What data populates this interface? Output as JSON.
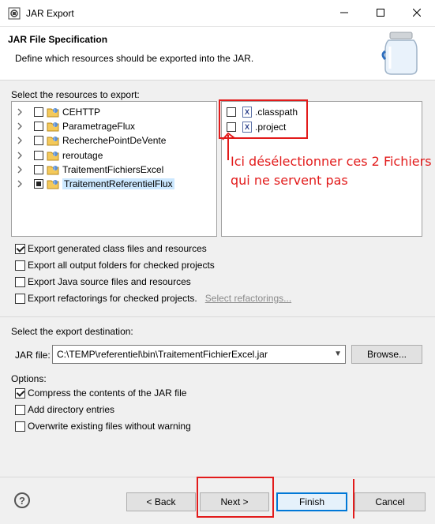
{
  "window": {
    "title": "JAR Export"
  },
  "header": {
    "title": "JAR File Specification",
    "description": "Define which resources should be exported into the JAR."
  },
  "resources": {
    "label": "Select the resources to export:",
    "projects": [
      {
        "name": "CEHTTP",
        "state": "unchecked",
        "selected": false
      },
      {
        "name": "ParametrageFlux",
        "state": "unchecked",
        "selected": false
      },
      {
        "name": "RecherchePointDeVente",
        "state": "unchecked",
        "selected": false
      },
      {
        "name": "reroutage",
        "state": "unchecked",
        "selected": false
      },
      {
        "name": "TraitementFichiersExcel",
        "state": "unchecked",
        "selected": false
      },
      {
        "name": "TraitementReferentielFlux",
        "state": "partial",
        "selected": true
      }
    ],
    "files": [
      {
        "name": ".classpath",
        "checked": false
      },
      {
        "name": ".project",
        "checked": false
      }
    ]
  },
  "annotation": {
    "line1": "Ici désélectionner ces 2 Fichiers",
    "line2": "qui ne servent pas",
    "color": "#e21b1b"
  },
  "export_options": [
    {
      "label": "Export generated class files and resources",
      "checked": true
    },
    {
      "label": "Export all output folders for checked projects",
      "checked": false
    },
    {
      "label": "Export Java source files and resources",
      "checked": false
    },
    {
      "label": "Export refactorings for checked projects.",
      "checked": false
    }
  ],
  "select_refactorings_link": "Select refactorings...",
  "destination": {
    "label": "Select the export destination:",
    "jar_label": "JAR file:",
    "jar_value": "C:\\TEMP\\referentiel\\bin\\TraitementFichierExcel.jar",
    "browse_label": "Browse..."
  },
  "options": {
    "label": "Options:",
    "items": [
      {
        "label": "Compress the contents of the JAR file",
        "checked": true
      },
      {
        "label": "Add directory entries",
        "checked": false
      },
      {
        "label": "Overwrite existing files without warning",
        "checked": false
      }
    ]
  },
  "buttons": {
    "help": "?",
    "back": "< Back",
    "next": "Next >",
    "finish": "Finish",
    "cancel": "Cancel"
  },
  "icons": {
    "app": "jar-export-icon",
    "minimize": "minimize-icon",
    "maximize": "maximize-icon",
    "close": "close-icon",
    "jar": "jar-icon",
    "project": "java-project-icon",
    "file": "xml-file-icon"
  }
}
